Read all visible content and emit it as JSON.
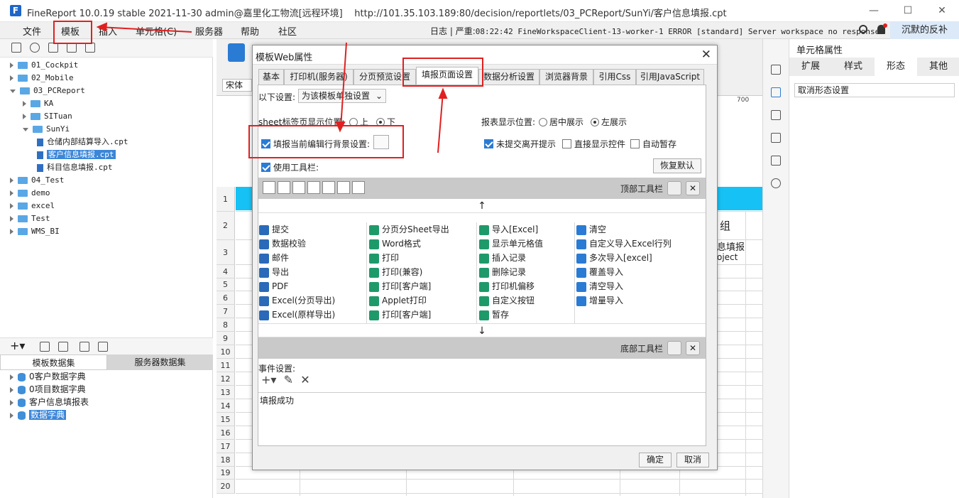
{
  "window": {
    "title": "FineReport 10.0.19 stable 2021-11-30 admin@嘉里化工物流[远程环境]",
    "url": "http://101.35.103.189:80/decision/reportlets/03_PCReport/SunYi/客户信息填报.cpt",
    "logo": "F",
    "controls": [
      "—",
      "☐",
      "✕"
    ]
  },
  "menubar": {
    "items": [
      "文件",
      "模板",
      "插入",
      "单元格(C)",
      "服务器",
      "帮助",
      "社区"
    ],
    "log": "日志",
    "severity": "严重",
    "message": "08:22:42 FineWorkspaceClient-13-worker-1 ERROR [standard] Server workspace no response.",
    "user": "沉默的反补"
  },
  "tree": [
    {
      "label": "01_Cockpit",
      "type": "folder",
      "depth": 0,
      "open": false
    },
    {
      "label": "02_Mobile",
      "type": "folder",
      "depth": 0,
      "open": false
    },
    {
      "label": "03_PCReport",
      "type": "folder",
      "depth": 0,
      "open": true
    },
    {
      "label": "KA",
      "type": "folder",
      "depth": 1,
      "open": false
    },
    {
      "label": "SITuan",
      "type": "folder",
      "depth": 1,
      "open": false
    },
    {
      "label": "SunYi",
      "type": "folder",
      "depth": 1,
      "open": true
    },
    {
      "label": "仓储内部结算导入.cpt",
      "type": "file",
      "depth": 2
    },
    {
      "label": "客户信息填报.cpt",
      "type": "file",
      "depth": 2,
      "selected": true
    },
    {
      "label": "科目信息填报.cpt",
      "type": "file",
      "depth": 2
    },
    {
      "label": "04_Test",
      "type": "folder",
      "depth": 0,
      "open": false
    },
    {
      "label": "demo",
      "type": "folder",
      "depth": 0,
      "open": false
    },
    {
      "label": "excel",
      "type": "folder",
      "depth": 0,
      "open": false
    },
    {
      "label": "Test",
      "type": "folder",
      "depth": 0,
      "open": false
    },
    {
      "label": "WMS_BI",
      "type": "folder",
      "depth": 0,
      "open": false
    }
  ],
  "datasets": {
    "tab_template": "模板数据集",
    "tab_server": "服务器数据集",
    "items": [
      "0客户数据字典",
      "0项目数据字典",
      "客户信息填报表",
      "数据字典"
    ]
  },
  "sheet": {
    "font": "宋体",
    "ruler": "700",
    "rows": [
      "1",
      "2",
      "3",
      "4",
      "5",
      "6",
      "7",
      "8",
      "9",
      "10",
      "11",
      "12",
      "13",
      "14",
      "15",
      "16",
      "17",
      "18",
      "19",
      "20"
    ],
    "cell_group": "组",
    "cell_fill": "息填报",
    "cell_obj": "oject"
  },
  "rightpanel": {
    "title": "单元格属性",
    "tabs": [
      "扩展",
      "样式",
      "形态",
      "其他"
    ],
    "select": "取消形态设置"
  },
  "dialog": {
    "title": "模板Web属性",
    "tabs": [
      "基本",
      "打印机(服务器)",
      "分页预览设置",
      "填报页面设置",
      "数据分析设置",
      "浏览器背景",
      "引用Css",
      "引用JavaScript"
    ],
    "settings_label": "以下设置:",
    "settings_value": "为该模板单独设置",
    "sheet_pos_label": "sheet标签页显示位置:",
    "opt_top": "上",
    "opt_bottom": "下",
    "report_pos_label": "报表显示位置:",
    "opt_center": "居中展示",
    "opt_left": "左展示",
    "bg_label": "填报当前编辑行背景设置:",
    "unsubmit": "未提交离开提示",
    "direct_ctrl": "直接显示控件",
    "autosave": "自动暂存",
    "use_toolbar": "使用工具栏:",
    "restore": "恢复默认",
    "top_toolbar": "顶部工具栏",
    "bottom_toolbar": "底部工具栏",
    "items": [
      [
        "提交",
        "分页分Sheet导出",
        "导入[Excel]",
        "清空"
      ],
      [
        "数据校验",
        "Word格式",
        "显示单元格值",
        "自定义导入Excel行列"
      ],
      [
        "邮件",
        "打印",
        "插入记录",
        "多次导入[excel]"
      ],
      [
        "导出",
        "打印(兼容)",
        "删除记录",
        "覆盖导入"
      ],
      [
        "PDF",
        "打印[客户端]",
        "打印机偏移",
        "清空导入"
      ],
      [
        "Excel(分页导出)",
        "Applet打印",
        "自定义按钮",
        "增量导入"
      ],
      [
        "Excel(原样导出)",
        "打印[客户端]",
        "暂存",
        ""
      ]
    ],
    "event_label": "事件设置:",
    "event_item": "填报成功",
    "ok": "确定",
    "cancel": "取消"
  },
  "colors": {
    "accent": "#2a7bd4",
    "annotation": "#e02020",
    "header_cyan": "#16c2f5"
  }
}
